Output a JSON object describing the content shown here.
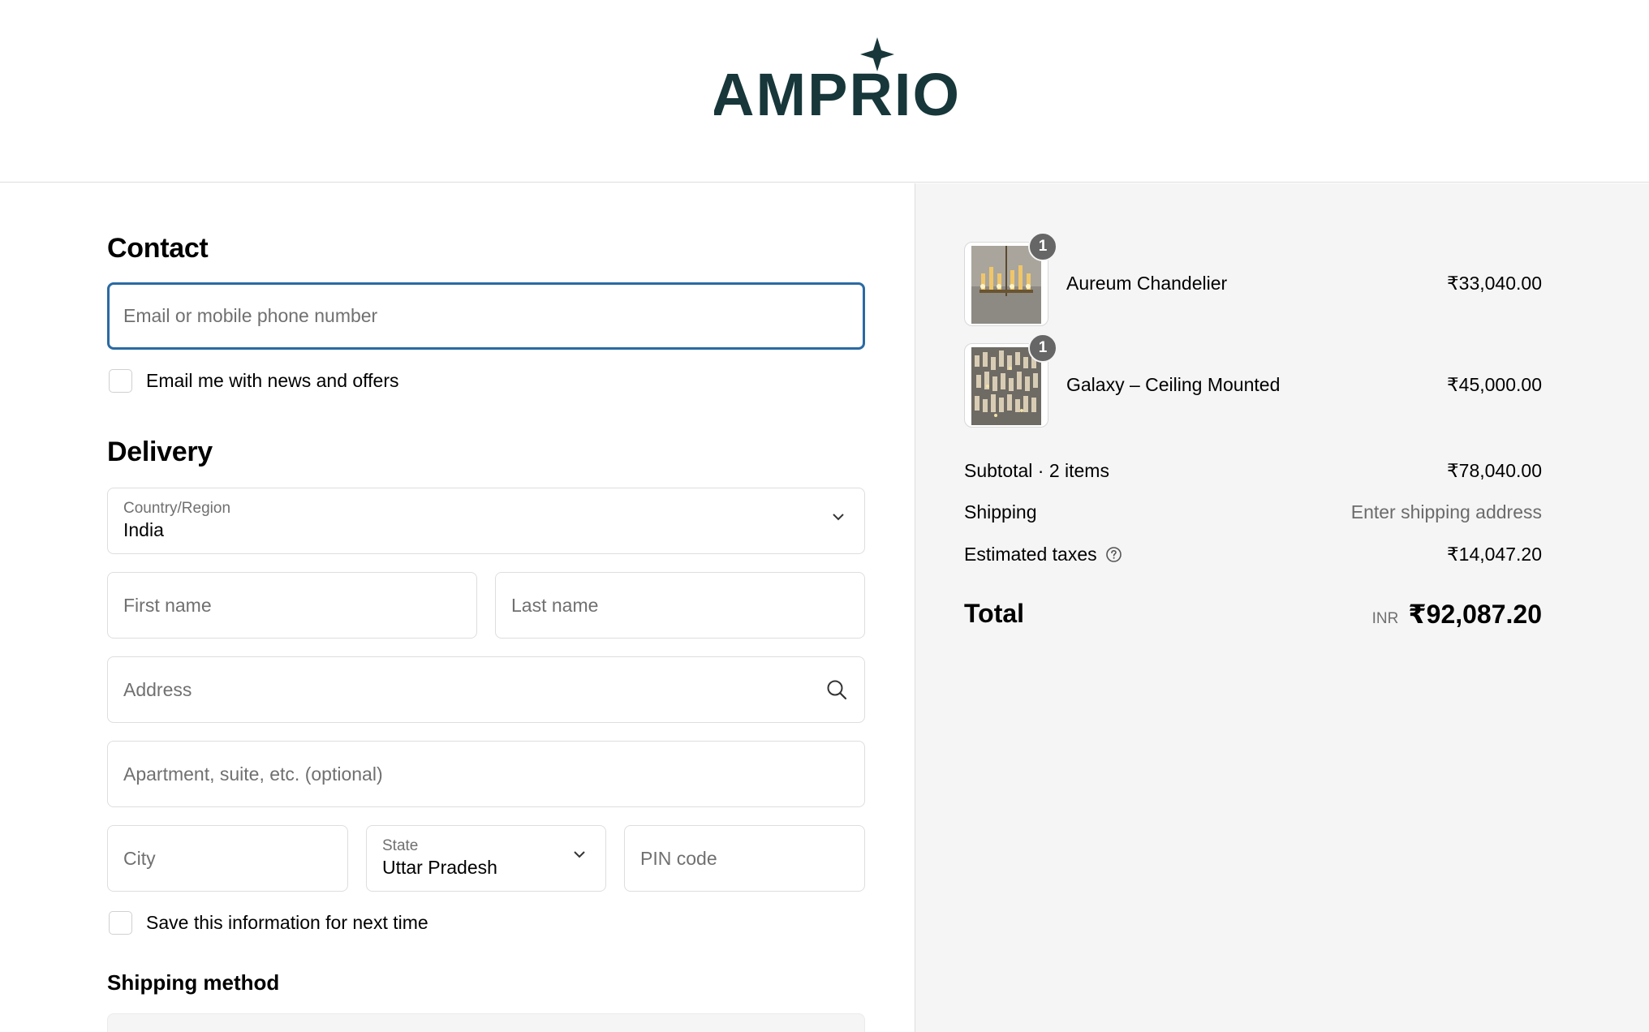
{
  "brand": {
    "logo_text": "AMPRIO",
    "color": "#17373a"
  },
  "contact": {
    "heading": "Contact",
    "email_placeholder": "Email or mobile phone number",
    "newsletter_label": "Email me with news and offers"
  },
  "delivery": {
    "heading": "Delivery",
    "country_label": "Country/Region",
    "country_value": "India",
    "first_name_placeholder": "First name",
    "last_name_placeholder": "Last name",
    "address_placeholder": "Address",
    "apartment_placeholder": "Apartment, suite, etc. (optional)",
    "city_placeholder": "City",
    "state_label": "State",
    "state_value": "Uttar Pradesh",
    "pin_placeholder": "PIN code",
    "save_info_label": "Save this information for next time"
  },
  "shipping_method": {
    "heading": "Shipping method"
  },
  "summary": {
    "items": [
      {
        "qty": "1",
        "name": "Aureum Chandelier",
        "price": "₹33,040.00"
      },
      {
        "qty": "1",
        "name": "Galaxy – Ceiling Mounted",
        "price": "₹45,000.00"
      }
    ],
    "subtotal_label": "Subtotal · 2 items",
    "subtotal_value": "₹78,040.00",
    "shipping_label": "Shipping",
    "shipping_value": "Enter shipping address",
    "taxes_label": "Estimated taxes",
    "taxes_value": "₹14,047.20",
    "total_label": "Total",
    "total_currency": "INR",
    "total_value": "₹92,087.20"
  },
  "colors": {
    "focus": "#2a6aa3",
    "summary_bg": "#f5f5f5",
    "badge": "#666666"
  },
  "icons": [
    "chevron-down-icon",
    "search-icon",
    "help-icon"
  ]
}
